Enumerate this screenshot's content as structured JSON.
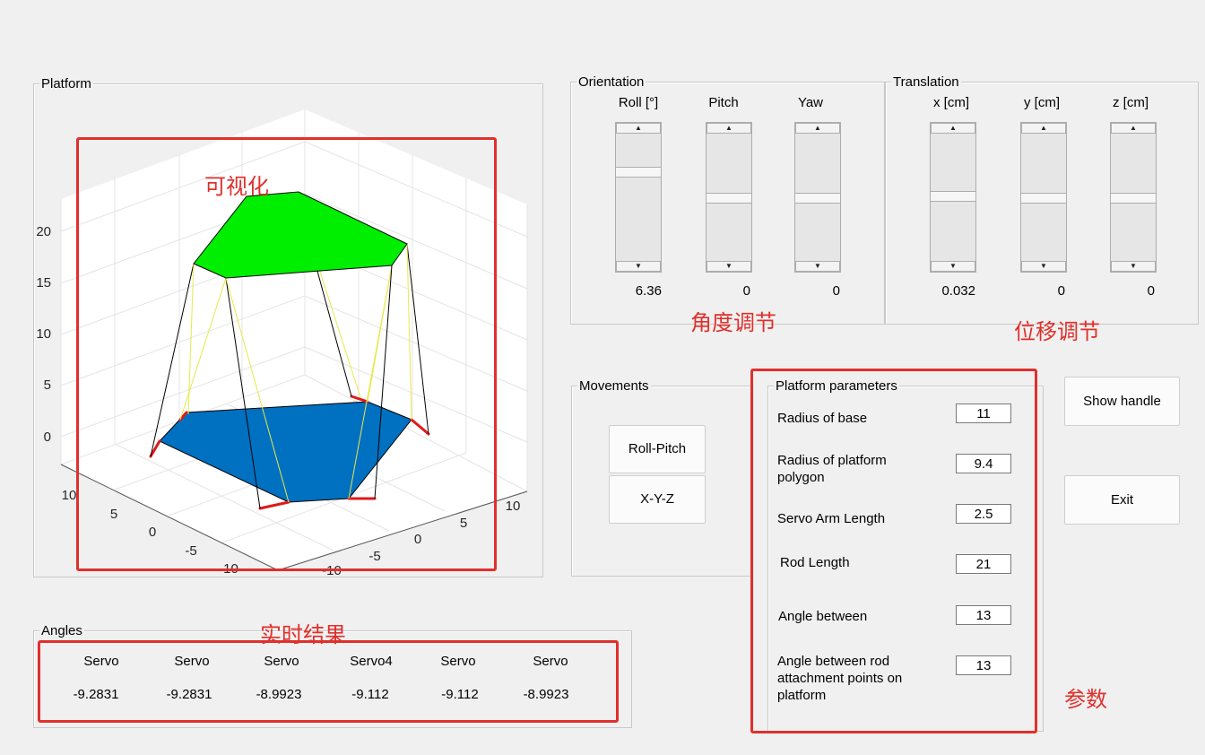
{
  "platform_panel": {
    "title": "Platform",
    "z_ticks": [
      "20",
      "15",
      "10",
      "5",
      "0"
    ],
    "x_ticks": [
      "10",
      "5",
      "0",
      "-5",
      "-10"
    ],
    "y_ticks": [
      "10",
      "5",
      "0",
      "-5",
      "-10"
    ],
    "top_color": "#00ee00",
    "base_color": "#0070c0"
  },
  "orientation": {
    "title": "Orientation",
    "headers": [
      "Roll [°]",
      "Pitch",
      "Yaw"
    ],
    "values": [
      "6.36",
      "0",
      "0"
    ],
    "slider_levels": [
      0.32,
      0.5,
      0.5
    ]
  },
  "translation": {
    "title": "Translation",
    "headers": [
      "x [cm]",
      "y [cm]",
      "z [cm]"
    ],
    "values": [
      "0.032",
      "0",
      "0"
    ],
    "slider_levels": [
      0.5,
      0.5,
      0.5
    ]
  },
  "movements": {
    "title": "Movements",
    "roll_pitch_label": "Roll-Pitch",
    "xyz_label": "X-Y-Z"
  },
  "platform_parameters": {
    "title": "Platform parameters",
    "items": [
      {
        "label": "Radius of base",
        "value": "11"
      },
      {
        "label": "Radius of platform polygon",
        "value": "9.4"
      },
      {
        "label": "Servo Arm Length",
        "value": "2.5"
      },
      {
        "label": "Rod Length",
        "value": "21"
      },
      {
        "label": "Angle between",
        "value": "13"
      },
      {
        "label": "Angle between rod attachment points on platform",
        "value": "13"
      }
    ]
  },
  "buttons": {
    "show_handle": "Show handle",
    "exit": "Exit"
  },
  "angles": {
    "title": "Angles",
    "headers": [
      "Servo",
      "Servo",
      "Servo",
      "Servo4",
      "Servo",
      "Servo"
    ],
    "values": [
      "-9.2831",
      "-9.2831",
      "-8.9923",
      "-9.112",
      "-9.112",
      "-8.9923"
    ]
  },
  "annotations": {
    "visualization": "可视化",
    "angle_adjust": "角度调节",
    "displacement_adjust": "位移调节",
    "realtime_result": "实时结果",
    "parameters": "参数",
    "color": "#e0302c"
  }
}
